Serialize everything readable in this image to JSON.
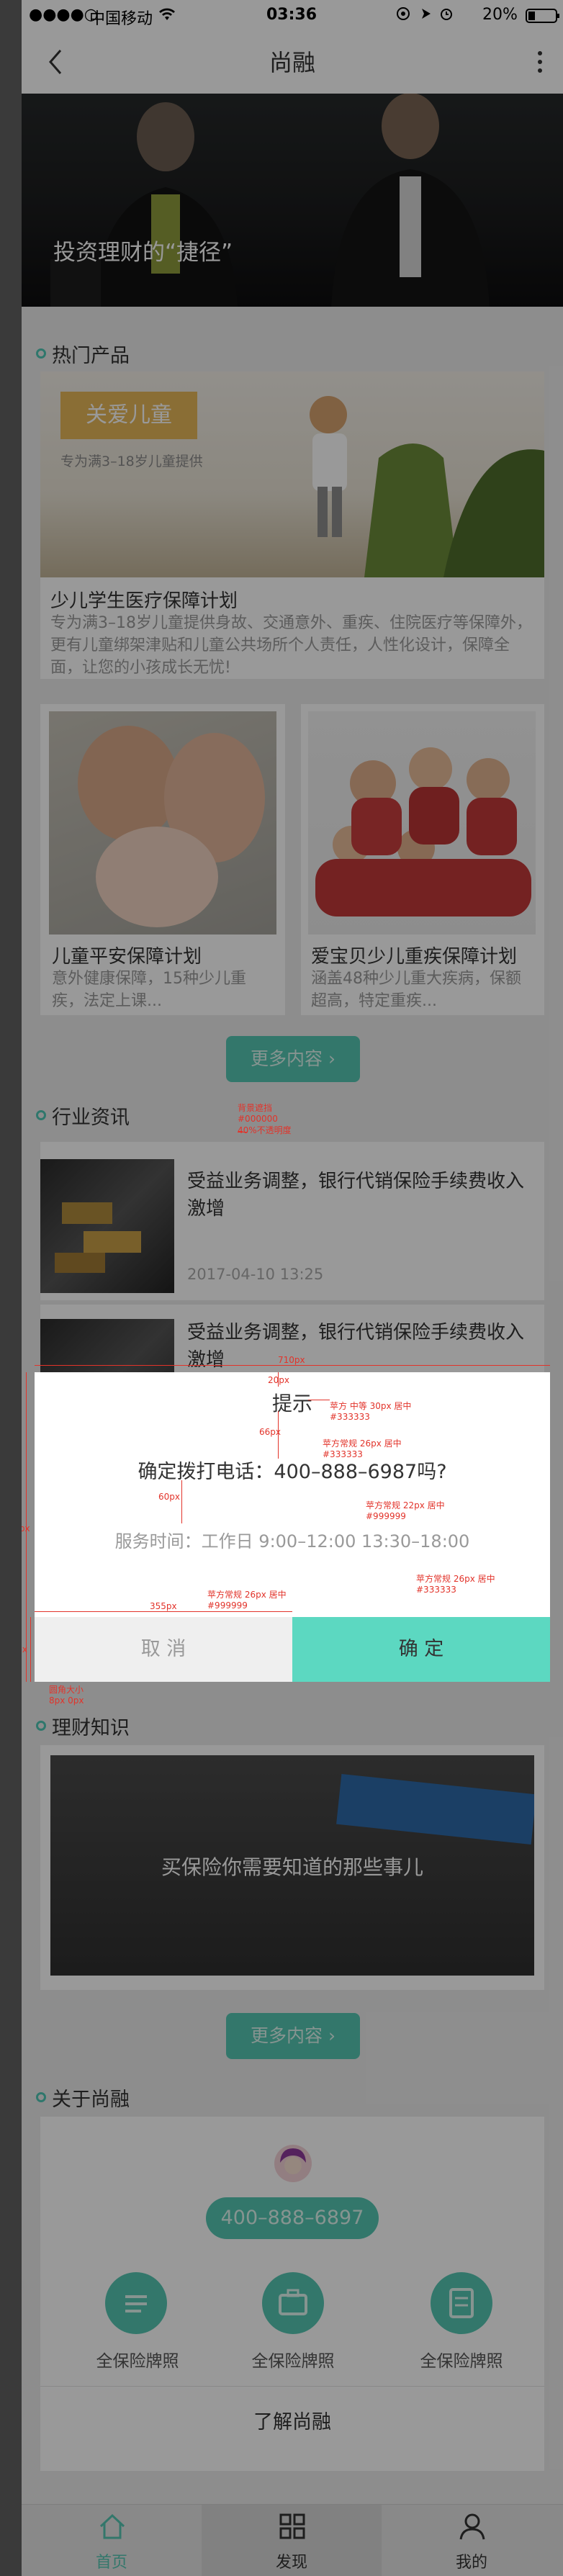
{
  "status_bar": {
    "signal": "●●●●○",
    "carrier": "中国移动",
    "time": "03:36",
    "battery": "20%"
  },
  "nav": {
    "title": "尚融"
  },
  "banner": {
    "caption": "投资理财的“捷径”"
  },
  "hot": {
    "title": "热门产品",
    "featured": {
      "badge": "关爱儿童",
      "badge_sub": "专为满3–18岁儿童提供",
      "title": "少儿学生医疗保障计划",
      "desc": "专为满3–18岁儿童提供身故、交通意外、重疾、住院医疗等保障外，更有儿童绑架津贴和儿童公共场所个人责任，人性化设计，保障全面，让您的小孩成长无忧!"
    },
    "cards": [
      {
        "title": "儿童平安保障计划",
        "desc": "意外健康保障，15种少儿重疾，法定上课..."
      },
      {
        "title": "爱宝贝少儿重疾保障计划",
        "desc": "涵盖48种少儿重大疾病，保额超高，特定重疾..."
      }
    ],
    "more": "更多内容 ›"
  },
  "news": {
    "title": "行业资讯",
    "items": [
      {
        "title": "受益业务调整，银行代销保险手续费收入激增",
        "date": "2017-04-10 13:25"
      },
      {
        "title": "受益业务调整，银行代销保险手续费收入激增",
        "date": ""
      }
    ]
  },
  "knowledge": {
    "title": "理财知识",
    "image_caption": "买保险你需要知道的那些事儿",
    "more": "更多内容 ›"
  },
  "about": {
    "title": "关于尚融",
    "phone": "400–888–6897",
    "features": [
      {
        "label": "全保险牌照"
      },
      {
        "label": "全保险牌照"
      },
      {
        "label": "全保险牌照"
      }
    ],
    "link": "了解尚融"
  },
  "tabbar": {
    "tabs": [
      {
        "label": "首页"
      },
      {
        "label": "发现"
      },
      {
        "label": "我的"
      }
    ]
  },
  "dialog": {
    "title": "提示",
    "message": "确定拨打电话：400–888–6987吗?",
    "sub": "服务时间：工作日 9:00–12:00   13:30–18:00",
    "cancel": "取   消",
    "confirm": "确   定"
  },
  "annotations": {
    "overlay_spec": [
      "背景遮挡",
      "#000000",
      "40%不透明度"
    ],
    "title_spec": [
      "苹方 中等 30px 居中",
      "#333333"
    ],
    "message_spec": [
      "苹方常规 26px 居中",
      "#333333"
    ],
    "sub_spec": [
      "苹方常规 22px 居中",
      "#999999"
    ],
    "cancel_spec": [
      "苹方常规 26px 居中",
      "#999999"
    ],
    "confirm_spec": [
      "苹方常规 26px 居中",
      "#333333"
    ],
    "width_710": "710px",
    "m20": "20px",
    "m66": "66px",
    "m60": "60px",
    "w355": "355px",
    "h90": "90px",
    "h430": "430px",
    "radius": [
      "圆角大小",
      "8px 0px"
    ]
  },
  "colors": {
    "accent": "#55c7b3",
    "confirm": "#5cd8c1",
    "annotation": "#e2332a",
    "overlay": "rgba(0,0,0,0.4)"
  },
  "icons": [
    "back-icon",
    "more-icon",
    "home-icon",
    "discover-icon",
    "profile-icon",
    "feature-icon"
  ]
}
